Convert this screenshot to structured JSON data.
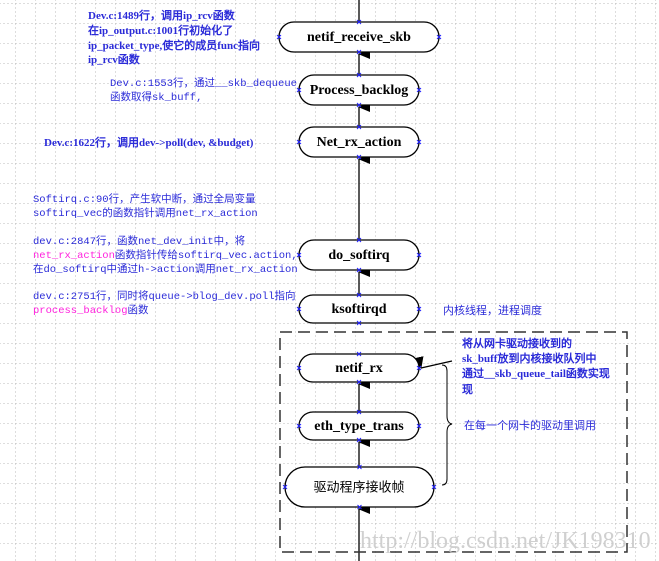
{
  "nodes": {
    "netif_receive_skb": "netif_receive_skb",
    "process_backlog": "Process_backlog",
    "net_rx_action": "Net_rx_action",
    "do_softirq": "do_softirq",
    "ksoftirqd": "ksoftirqd",
    "netif_rx": "netif_rx",
    "eth_type_trans": "eth_type_trans",
    "driver_receive": "驱动程序接收帧"
  },
  "notes": {
    "n1": [
      "Dev.c:1489行，调用ip_rcv函数",
      "在ip_output.c:1001行初始化了",
      "ip_packet_type,使它的成员func指向",
      "ip_rcv函数"
    ],
    "n2": [
      "Dev.c:1553行，通过__skb_dequeue",
      "函数取得sk_buff,"
    ],
    "n3": [
      "Dev.c:1622行，调用dev->poll(dev, &budget)"
    ],
    "n4": [
      "Softirq.c:90行，产生软中断，通过全局变量",
      "softirq_vec的函数指针调用net_rx_action"
    ],
    "n5": {
      "l1": "dev.c:2847行，函数net_dev_init中，将",
      "l2a": "net_rx_action",
      "l2b": "函数指针传给softirq_vec.action,",
      "l3": "在do_softirq中通过h->action调用net_rx_action"
    },
    "n6": {
      "l1": "dev.c:2751行，同时将queue->blog_dev.poll指向",
      "l2a": "process_backlog",
      "l2b": "函数"
    },
    "ksoftirqd_note": "内核线程，进程调度",
    "netif_rx_note": [
      "将从网卡驱动接收到的",
      "sk_buff放到内核接收队列中",
      "通过__skb_queue_tail函数实现",
      "现"
    ],
    "brace_note": "在每一个网卡的驱动里调用"
  },
  "watermark": "http://blog.csdn.net/JK198310",
  "colors": {
    "note": "#2b2bd8",
    "highlight": "#ff22dd",
    "grid": "#bbbbbb"
  }
}
